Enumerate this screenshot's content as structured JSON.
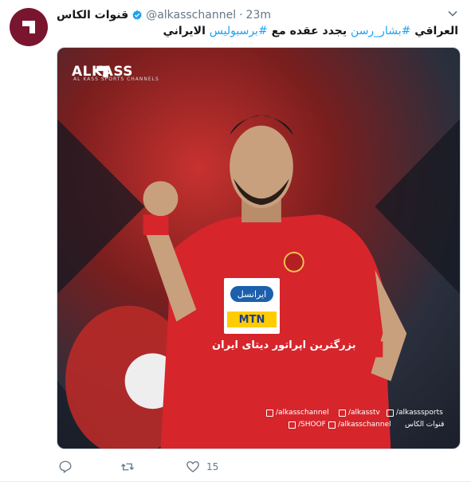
{
  "tweet": {
    "display_name": "قنوات الكاس",
    "handle": "@alkasschannel",
    "separator": "·",
    "time": "23m",
    "text_prefix": "العراقي",
    "hashtag_player": "#بشار_رسن",
    "text_middle": "يجدد عقده مع",
    "hashtag_club": "#برسبوليس",
    "text_suffix": "الايراني",
    "like_count": "15"
  },
  "media": {
    "brand_logo": "ALKASS",
    "brand_sub": "AL KASS SPORTS CHANNELS",
    "sponsor_top": "ايرانسل",
    "sponsor_bottom": "MTN",
    "jersey_text": "بزرگترین اپراتور دیتای ایران",
    "social_twitter": "/alkasschannel",
    "social_facebook": "/alkasstv",
    "social_instagram": "/alkasssports",
    "social_shoof": "/SHOOF",
    "social_youtube": "/alkasschannel",
    "channel_tag": "قنوات الكاس"
  },
  "colors": {
    "accent": "#1da1f2",
    "muted": "#657786",
    "avatar": "#7a1530",
    "jersey_red": "#d6252b"
  },
  "icons": [
    "alkass-logo-icon",
    "verified-icon",
    "chevron-down-icon",
    "reply-icon",
    "retweet-icon",
    "like-icon"
  ]
}
